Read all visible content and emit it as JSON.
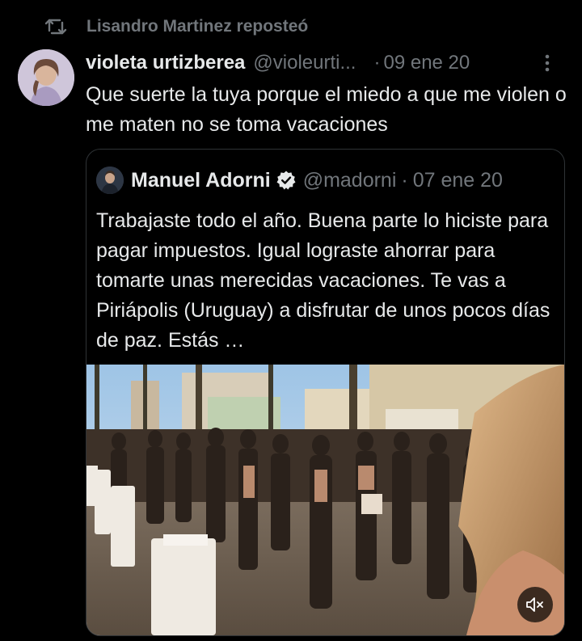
{
  "repost": {
    "label": "Lisandro Martinez reposteó",
    "icon": "repost-icon"
  },
  "tweet": {
    "display_name": "violeta urtizberea",
    "handle": "@violeurti...",
    "separator": "·",
    "time": "09 ene 20",
    "text": "Que suerte la tuya porque el miedo a que me violen o me maten no se toma vacaciones",
    "more_icon": "more-vertical-icon"
  },
  "quote": {
    "display_name": "Manuel Adorni",
    "verified_icon": "verified-badge-icon",
    "handle": "@madorni",
    "separator": "·",
    "time": "07 ene 20",
    "text": "Trabajaste todo el año. Buena parte lo hiciste para pagar impuestos. Igual lograste ahorrar para tomarte unas merecidas vacaciones. Te vas a Piriápolis (Uruguay) a disfrutar de unos pocos días de paz. Estás …",
    "media_icon": "mute-icon"
  },
  "colors": {
    "background": "#000000",
    "text": "#e7e9ea",
    "muted": "#71767b",
    "border": "#2f3336",
    "verified": "#1d9bf0"
  }
}
